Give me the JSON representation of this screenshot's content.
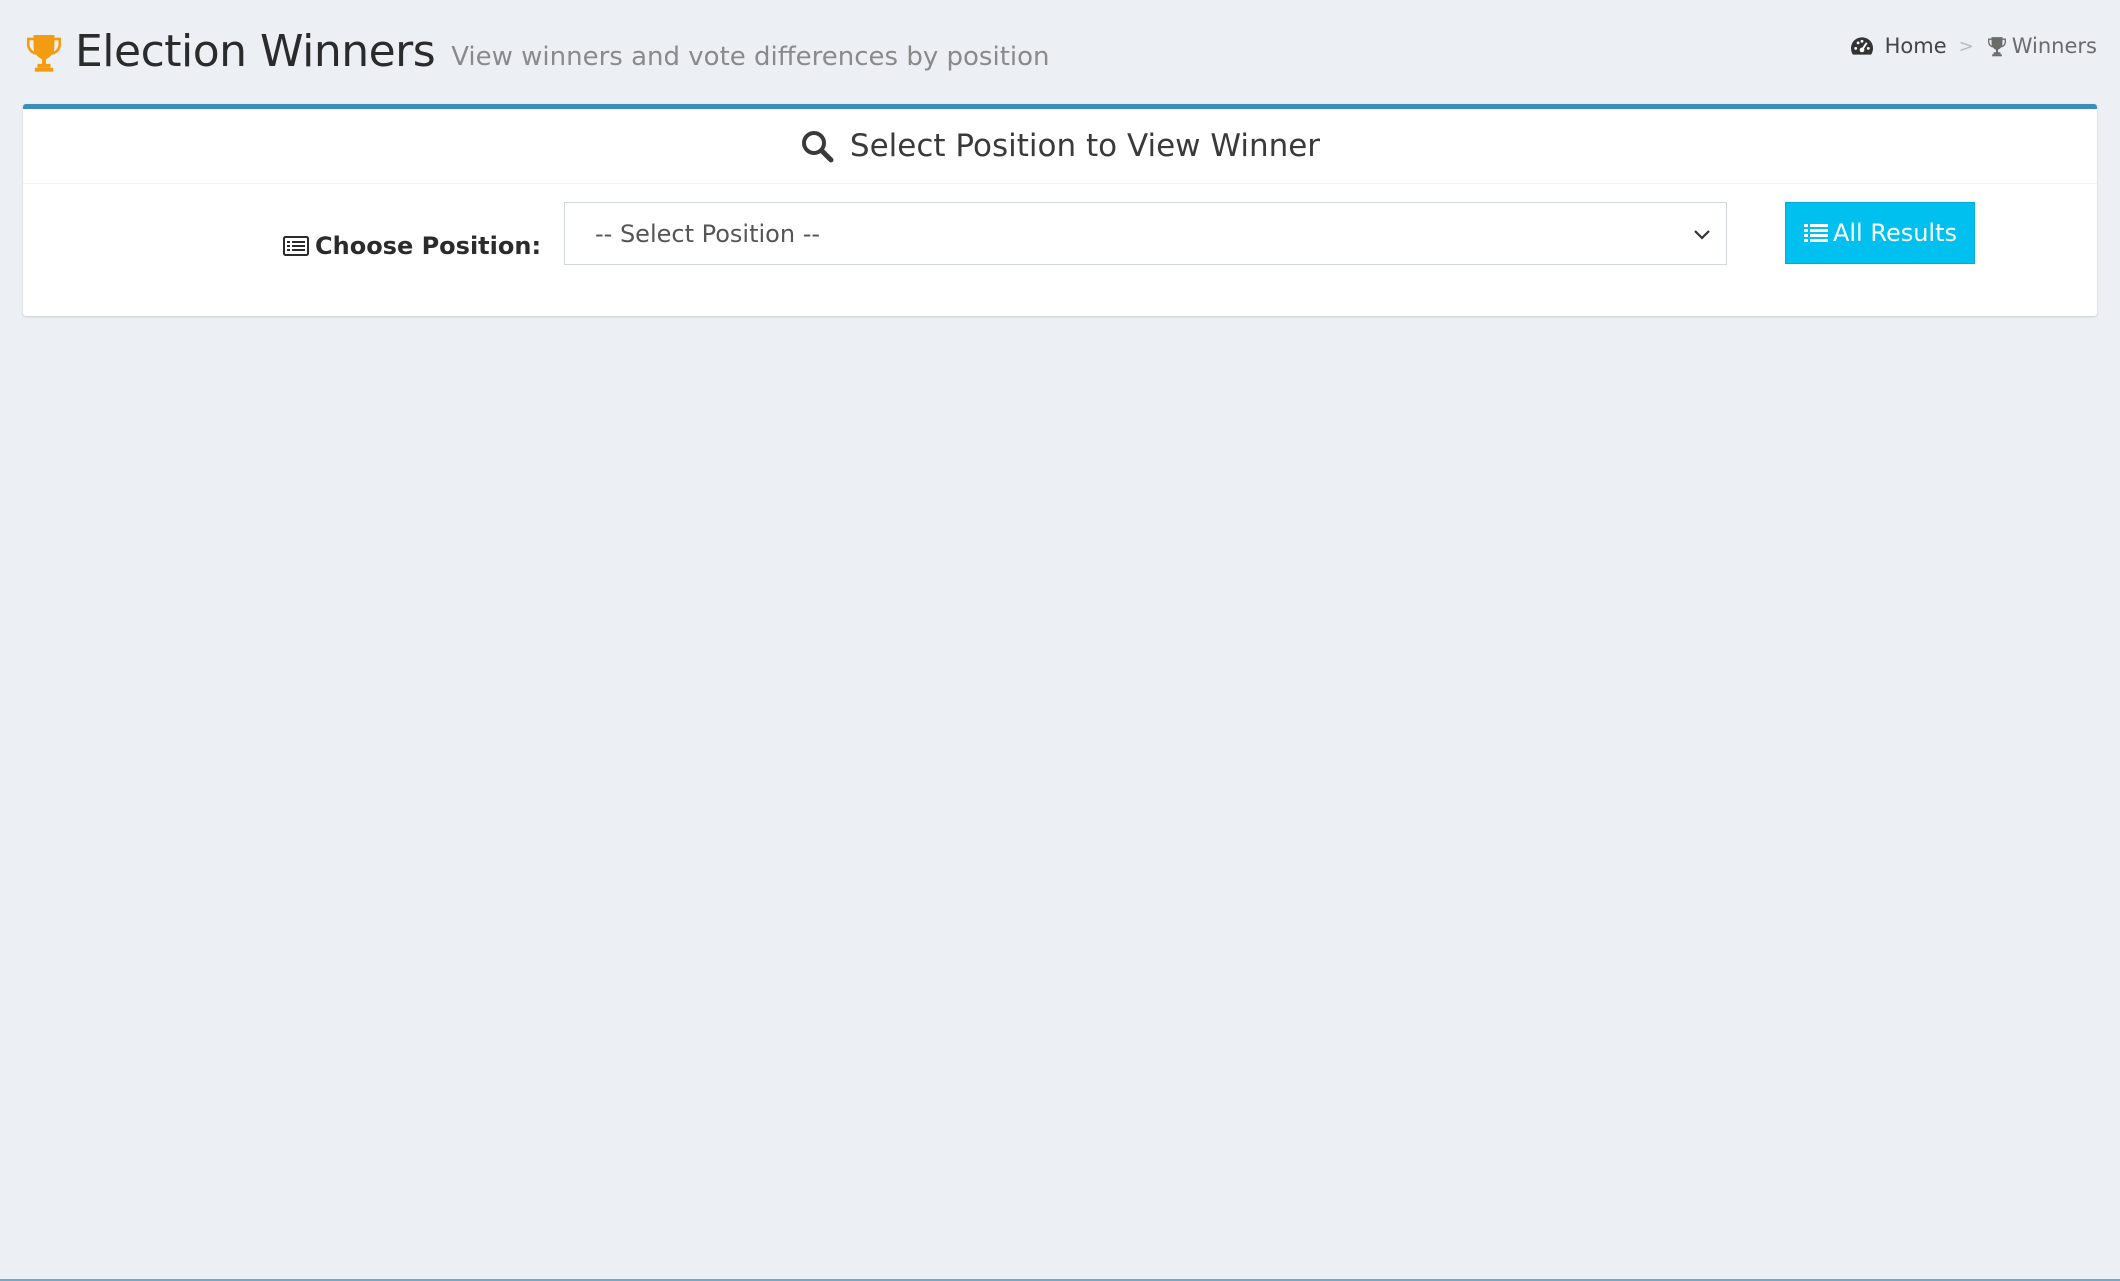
{
  "header": {
    "title": "Election Winners",
    "subtitle": "View winners and vote differences by position",
    "title_icon": "trophy-icon",
    "title_icon_color": "#f39c12"
  },
  "breadcrumb": {
    "items": [
      {
        "label": "Home",
        "icon": "dashboard-icon"
      },
      {
        "label": "Winners",
        "icon": "trophy-icon"
      }
    ],
    "separator": ">"
  },
  "box": {
    "title": "Select Position to View Winner",
    "title_icon": "search-icon",
    "accent_color": "#3c8dbc",
    "position_label": "Choose Position:",
    "position_label_icon": "list-alt-icon",
    "select": {
      "selected": "-- Select Position --"
    },
    "all_results_button": {
      "label": "All Results",
      "icon": "list-icon",
      "color": "#00c0ef"
    }
  }
}
